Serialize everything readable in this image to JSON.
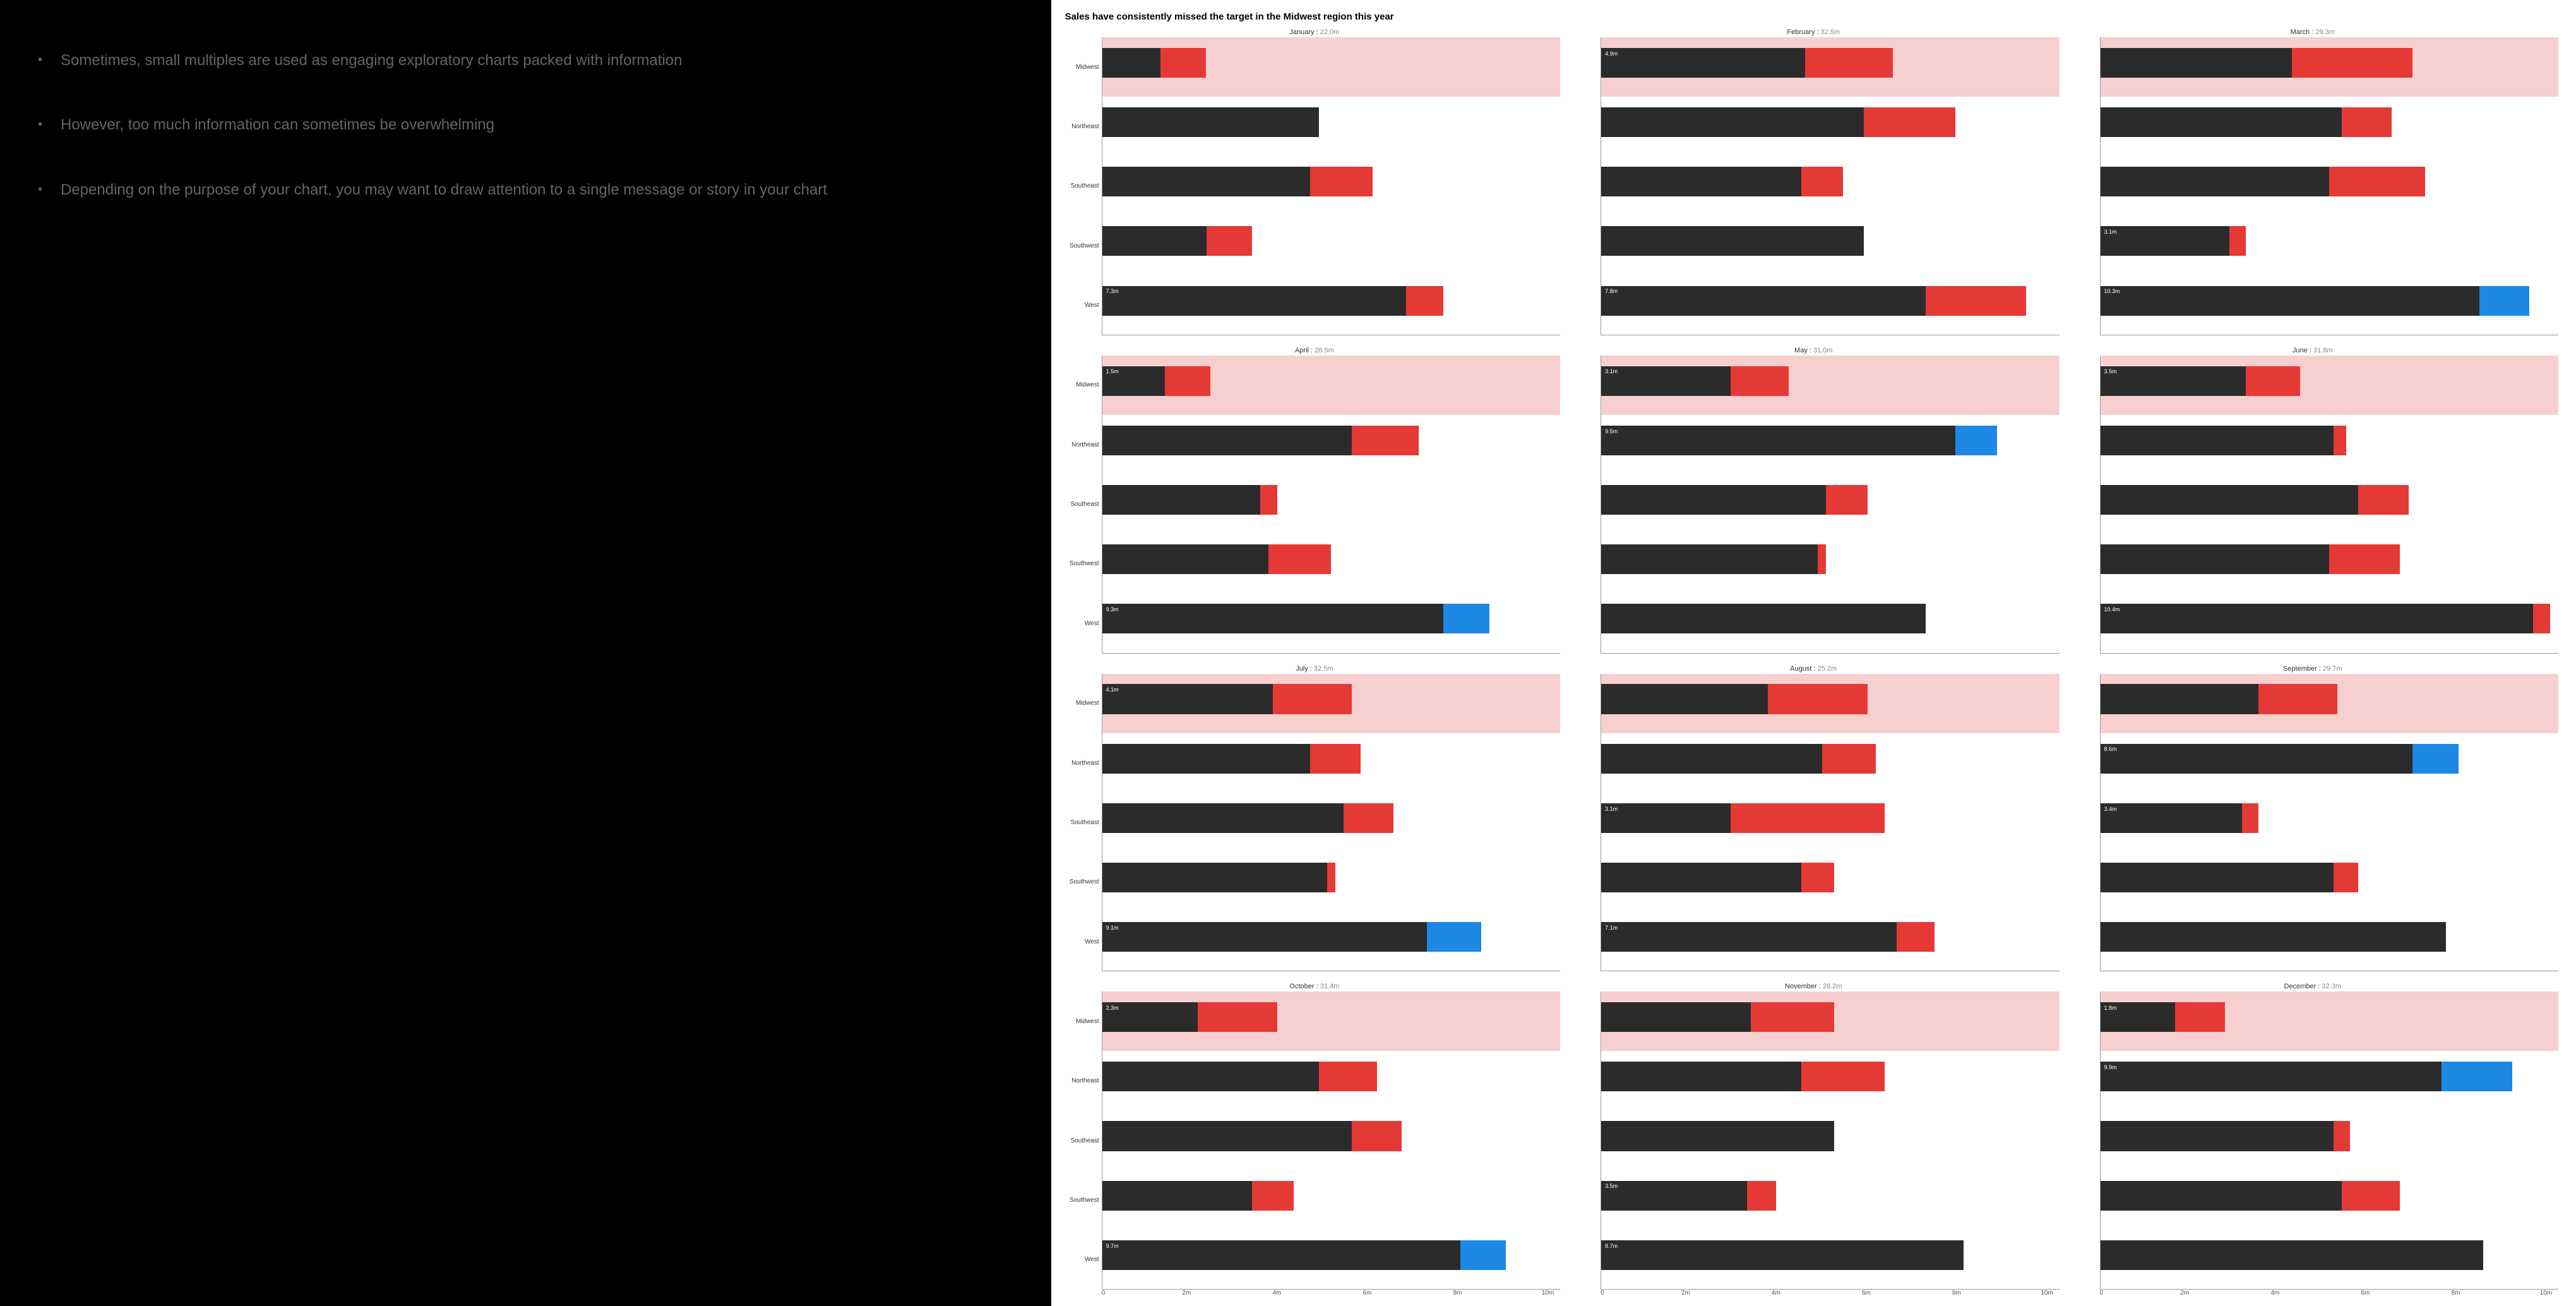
{
  "left_bullets": [
    "Sometimes, small multiples are used as engaging exploratory charts packed with information",
    "However, too much information can sometimes be overwhelming",
    "Depending on the purpose of your chart, you may want to draw attention to a single message or story in your chart"
  ],
  "chart_title": "Sales have consistently missed the target in the Midwest region this year",
  "regions": [
    "Midwest",
    "Northeast",
    "Southeast",
    "Southwest",
    "West"
  ],
  "highlight_region": "Midwest",
  "x_ticks": [
    "0",
    "2m",
    "4m",
    "6m",
    "8m",
    "10m"
  ],
  "x_max": 11,
  "chart_data": [
    {
      "month": "January",
      "total": "22.0m",
      "rows": [
        {
          "region": "Midwest",
          "actual": 1.4,
          "target": 2.5,
          "label": null
        },
        {
          "region": "Northeast",
          "actual": 5.2,
          "target": 5.2,
          "label": null
        },
        {
          "region": "Southeast",
          "actual": 5.0,
          "target": 6.5,
          "label": null
        },
        {
          "region": "Southwest",
          "actual": 2.5,
          "target": 3.6,
          "label": null
        },
        {
          "region": "West",
          "actual": 7.3,
          "target": 8.2,
          "label": "7.3m"
        }
      ]
    },
    {
      "month": "February",
      "total": "32.5m",
      "rows": [
        {
          "region": "Midwest",
          "actual": 4.9,
          "target": 7.0,
          "label": "4.9m"
        },
        {
          "region": "Northeast",
          "actual": 6.3,
          "target": 8.5,
          "label": null
        },
        {
          "region": "Southeast",
          "actual": 4.8,
          "target": 5.8,
          "label": null
        },
        {
          "region": "Southwest",
          "actual": 6.3,
          "target": 6.3,
          "label": null
        },
        {
          "region": "West",
          "actual": 7.8,
          "target": 10.2,
          "label": "7.8m"
        }
      ]
    },
    {
      "month": "March",
      "total": "29.3m",
      "rows": [
        {
          "region": "Midwest",
          "actual": 4.6,
          "target": 7.5,
          "label": null
        },
        {
          "region": "Northeast",
          "actual": 5.8,
          "target": 7.0,
          "label": null
        },
        {
          "region": "Southeast",
          "actual": 5.5,
          "target": 7.8,
          "label": null
        },
        {
          "region": "Southwest",
          "actual": 3.1,
          "target": 3.5,
          "label": "3.1m"
        },
        {
          "region": "West",
          "actual": 10.3,
          "target": 9.1,
          "label": "10.3m"
        }
      ]
    },
    {
      "month": "April",
      "total": "28.5m",
      "rows": [
        {
          "region": "Midwest",
          "actual": 1.5,
          "target": 2.6,
          "label": "1.5m"
        },
        {
          "region": "Northeast",
          "actual": 6.0,
          "target": 7.6,
          "label": null
        },
        {
          "region": "Southeast",
          "actual": 3.8,
          "target": 4.2,
          "label": null
        },
        {
          "region": "Southwest",
          "actual": 4.0,
          "target": 5.5,
          "label": null
        },
        {
          "region": "West",
          "actual": 9.3,
          "target": 8.2,
          "label": "9.3m"
        }
      ]
    },
    {
      "month": "May",
      "total": "31.0m",
      "rows": [
        {
          "region": "Midwest",
          "actual": 3.1,
          "target": 4.5,
          "label": "3.1m"
        },
        {
          "region": "Northeast",
          "actual": 9.5,
          "target": 8.5,
          "label": "9.5m"
        },
        {
          "region": "Southeast",
          "actual": 5.4,
          "target": 6.4,
          "label": null
        },
        {
          "region": "Southwest",
          "actual": 5.2,
          "target": 5.4,
          "label": null
        },
        {
          "region": "West",
          "actual": 7.8,
          "target": 7.8,
          "label": null
        }
      ]
    },
    {
      "month": "June",
      "total": "31.8m",
      "rows": [
        {
          "region": "Midwest",
          "actual": 3.5,
          "target": 4.8,
          "label": "3.5m"
        },
        {
          "region": "Northeast",
          "actual": 5.6,
          "target": 5.9,
          "label": null
        },
        {
          "region": "Southeast",
          "actual": 6.2,
          "target": 7.4,
          "label": null
        },
        {
          "region": "Southwest",
          "actual": 5.5,
          "target": 7.2,
          "label": null
        },
        {
          "region": "West",
          "actual": 10.4,
          "target": 10.8,
          "label": "10.4m"
        }
      ]
    },
    {
      "month": "July",
      "total": "32.5m",
      "rows": [
        {
          "region": "Midwest",
          "actual": 4.1,
          "target": 6.0,
          "label": "4.1m"
        },
        {
          "region": "Northeast",
          "actual": 5.0,
          "target": 6.2,
          "label": null
        },
        {
          "region": "Southeast",
          "actual": 5.8,
          "target": 7.0,
          "label": null
        },
        {
          "region": "Southwest",
          "actual": 5.4,
          "target": 5.6,
          "label": null
        },
        {
          "region": "West",
          "actual": 9.1,
          "target": 7.8,
          "label": "9.1m"
        }
      ]
    },
    {
      "month": "August",
      "total": "25.2m",
      "rows": [
        {
          "region": "Midwest",
          "actual": 4.0,
          "target": 6.4,
          "label": null
        },
        {
          "region": "Northeast",
          "actual": 5.3,
          "target": 6.6,
          "label": null
        },
        {
          "region": "Southeast",
          "actual": 3.1,
          "target": 6.8,
          "label": "3.1m"
        },
        {
          "region": "Southwest",
          "actual": 4.8,
          "target": 5.6,
          "label": null
        },
        {
          "region": "West",
          "actual": 7.1,
          "target": 8.0,
          "label": "7.1m"
        }
      ]
    },
    {
      "month": "September",
      "total": "29.7m",
      "rows": [
        {
          "region": "Midwest",
          "actual": 3.8,
          "target": 5.7,
          "label": null
        },
        {
          "region": "Northeast",
          "actual": 8.6,
          "target": 7.5,
          "label": "8.6m"
        },
        {
          "region": "Southeast",
          "actual": 3.4,
          "target": 3.8,
          "label": "3.4m"
        },
        {
          "region": "Southwest",
          "actual": 5.6,
          "target": 6.2,
          "label": null
        },
        {
          "region": "West",
          "actual": 8.3,
          "target": 8.3,
          "label": null
        }
      ]
    },
    {
      "month": "October",
      "total": "31.4m",
      "rows": [
        {
          "region": "Midwest",
          "actual": 2.3,
          "target": 4.2,
          "label": "2.3m"
        },
        {
          "region": "Northeast",
          "actual": 5.2,
          "target": 6.6,
          "label": null
        },
        {
          "region": "Southeast",
          "actual": 6.0,
          "target": 7.2,
          "label": null
        },
        {
          "region": "Southwest",
          "actual": 3.6,
          "target": 4.6,
          "label": null
        },
        {
          "region": "West",
          "actual": 9.7,
          "target": 8.6,
          "label": "9.7m"
        }
      ]
    },
    {
      "month": "November",
      "total": "28.2m",
      "rows": [
        {
          "region": "Midwest",
          "actual": 3.6,
          "target": 5.6,
          "label": null
        },
        {
          "region": "Northeast",
          "actual": 4.8,
          "target": 6.8,
          "label": null
        },
        {
          "region": "Southeast",
          "actual": 5.6,
          "target": 5.6,
          "label": null
        },
        {
          "region": "Southwest",
          "actual": 3.5,
          "target": 4.2,
          "label": "3.5m"
        },
        {
          "region": "West",
          "actual": 8.7,
          "target": 8.7,
          "label": "8.7m"
        }
      ]
    },
    {
      "month": "December",
      "total": "32.3m",
      "rows": [
        {
          "region": "Midwest",
          "actual": 1.8,
          "target": 3.0,
          "label": "1.8m"
        },
        {
          "region": "Northeast",
          "actual": 9.9,
          "target": 8.2,
          "label": "9.9m"
        },
        {
          "region": "Southeast",
          "actual": 5.6,
          "target": 6.0,
          "label": null
        },
        {
          "region": "Southwest",
          "actual": 5.8,
          "target": 7.2,
          "label": null
        },
        {
          "region": "West",
          "actual": 9.2,
          "target": 9.2,
          "label": null
        }
      ]
    }
  ]
}
